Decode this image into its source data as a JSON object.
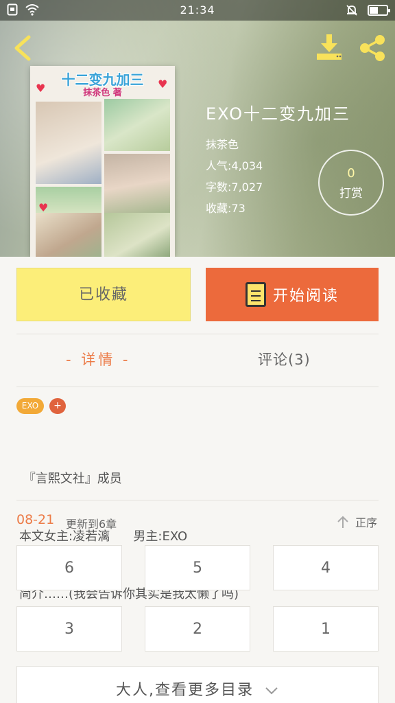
{
  "status_bar": {
    "time": "21:34"
  },
  "book": {
    "cover_title": "十二变九加三",
    "cover_author": "抹茶色 著",
    "title": "EXO十二变九加三",
    "author": "抹茶色",
    "popularity": "人气:4,034",
    "word_count": "字数:7,027",
    "favorites": "收藏:73"
  },
  "reward": {
    "count": "0",
    "label": "打赏"
  },
  "actions": {
    "collected_label": "已收藏",
    "read_label": "开始阅读"
  },
  "tabs": {
    "detail": "- 详情 -",
    "comments": "评论(3)"
  },
  "tags": {
    "exo": "EXO",
    "add": "+"
  },
  "synopsis": {
    "line1": " 『言熙文社』成员",
    "line2": "本文女主:凌若漓      男主:EXO",
    "line3": "简介……(我会告诉你其实是我太懒了吗)"
  },
  "updates": {
    "date": "08-21",
    "text": "更新到6章",
    "sort_label": "正序"
  },
  "chapters": [
    "6",
    "5",
    "4",
    "3",
    "2",
    "1"
  ],
  "more_label": "大人,查看更多目录",
  "colors": {
    "accent": "#ec6a3c",
    "collected": "#fcee79",
    "icon_yellow": "#fce36b"
  }
}
